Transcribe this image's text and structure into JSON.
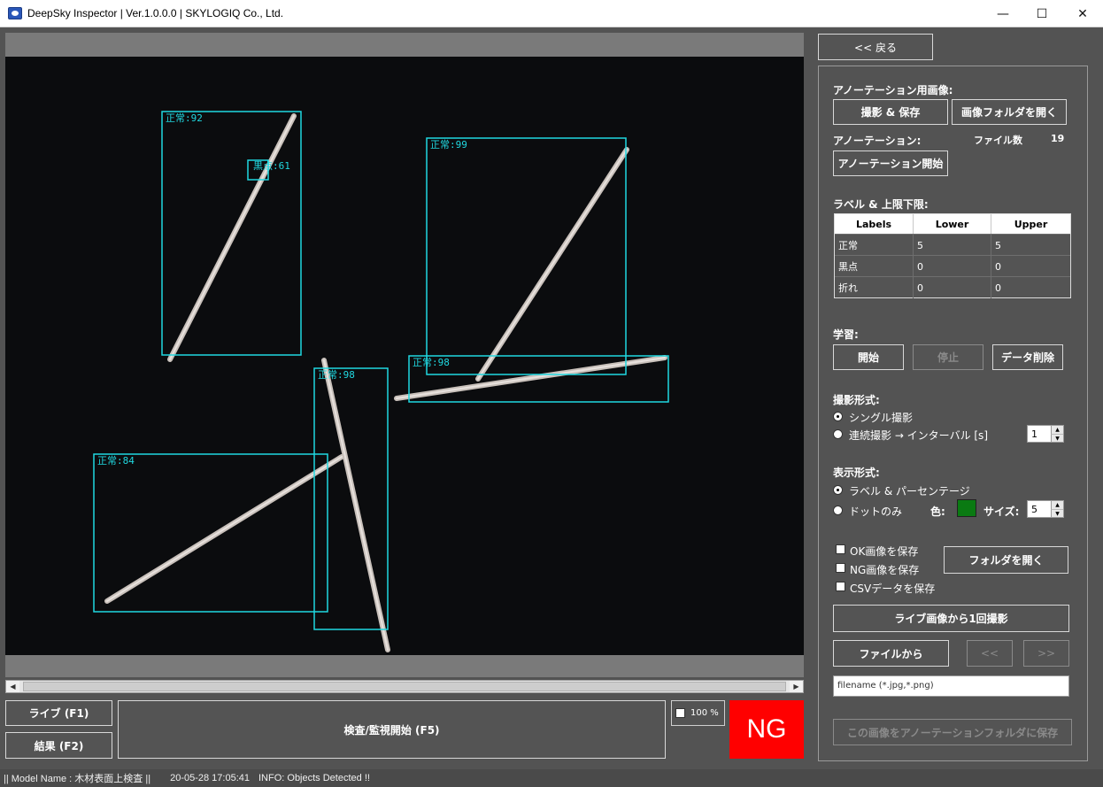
{
  "window": {
    "title": "DeepSky Inspector | Ver.1.0.0.0 | SKYLOGIQ Co., Ltd.",
    "min": "—",
    "max": "☐",
    "close": "✕"
  },
  "detections": [
    {
      "label": "正常:92"
    },
    {
      "label": "黒点:61"
    },
    {
      "label": "正常:99"
    },
    {
      "label": "正常:98"
    },
    {
      "label": "正常:98"
    },
    {
      "label": "正常:84"
    }
  ],
  "colors": {
    "detection_box": "#20d8e0",
    "ng": "#ff0000",
    "dot_color": "#0a7a12"
  },
  "controls": {
    "live_btn": "ライブ (F1)",
    "result_btn": "結果 (F2)",
    "inspect_btn": "検査/監視開始 (F5)",
    "zoom_label": "100 %",
    "ng_text": "NG"
  },
  "status": {
    "model": "|| Model Name : 木材表面上検査 ||",
    "timestamp": "20-05-28 17:05:41",
    "info": "INFO:  Objects Detected !!"
  },
  "panel": {
    "back_btn": "<< 戻る",
    "annot_image_label": "アノーテーション用画像:",
    "capture_save_btn": "撮影 & 保存",
    "open_image_folder_btn": "画像フォルダを開く",
    "annotation_label": "アノーテーション:",
    "file_count_label": "ファイル数",
    "file_count": "19",
    "start_annotation_btn": "アノーテーション開始",
    "label_limits_label": "ラベル & 上限下限:",
    "table": {
      "headers": [
        "Labels",
        "Lower",
        "Upper"
      ],
      "rows": [
        [
          "正常",
          "5",
          "5"
        ],
        [
          "黒点",
          "0",
          "0"
        ],
        [
          "折れ",
          "0",
          "0"
        ]
      ]
    },
    "learning_label": "学習:",
    "learn_start_btn": "開始",
    "learn_stop_btn": "停止",
    "delete_data_btn": "データ削除",
    "capture_mode_label": "撮影形式:",
    "single_capture": "シングル撮影",
    "continuous_capture": "連続撮影 → インターバル [s]",
    "interval_value": "1",
    "display_mode_label": "表示形式:",
    "label_percentage": "ラベル & パーセンテージ",
    "dots_only": "ドットのみ",
    "color_label": "色:",
    "size_label": "サイズ:",
    "size_value": "5",
    "save_ok": "OK画像を保存",
    "save_ng": "NG画像を保存",
    "save_csv": "CSVデータを保存",
    "open_folder_btn": "フォルダを開く",
    "capture_once_btn": "ライブ画像から1回撮影",
    "from_file_btn": "ファイルから",
    "prev_btn": "<<",
    "next_btn": ">>",
    "filename_placeholder": "filename (*.jpg,*.png)",
    "save_to_annotation_btn": "この画像をアノーテーションフォルダに保存"
  }
}
